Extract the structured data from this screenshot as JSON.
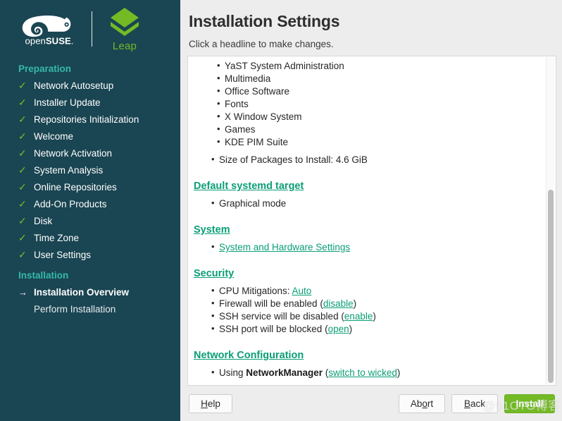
{
  "sidebar": {
    "brand": {
      "suse_logo": "opensuse-chameleon-logo",
      "product_name": "Leap"
    },
    "groups": [
      {
        "title": "Preparation",
        "items": [
          {
            "label": "Network Autosetup",
            "mark": "check"
          },
          {
            "label": "Installer Update",
            "mark": "check"
          },
          {
            "label": "Repositories Initialization",
            "mark": "check"
          },
          {
            "label": "Welcome",
            "mark": "check"
          },
          {
            "label": "Network Activation",
            "mark": "check"
          },
          {
            "label": "System Analysis",
            "mark": "check"
          },
          {
            "label": "Online Repositories",
            "mark": "check"
          },
          {
            "label": "Add-On Products",
            "mark": "check"
          },
          {
            "label": "Disk",
            "mark": "check"
          },
          {
            "label": "Time Zone",
            "mark": "check"
          },
          {
            "label": "User Settings",
            "mark": "check"
          }
        ]
      },
      {
        "title": "Installation",
        "items": [
          {
            "label": "Installation Overview",
            "mark": "arrow",
            "current": true
          },
          {
            "label": "Perform Installation",
            "mark": "none"
          }
        ]
      }
    ],
    "check_glyph": "✓",
    "arrow_glyph": "→"
  },
  "main": {
    "title": "Installation Settings",
    "subtitle": "Click a headline to make changes.",
    "software": {
      "nested_items": [
        "YaST System Administration",
        "Multimedia",
        "Office Software",
        "Fonts",
        "X Window System",
        "Games",
        "KDE PIM Suite"
      ],
      "size_line": "Size of Packages to Install: 4.6 GiB"
    },
    "sections": [
      {
        "heading": "Default systemd target",
        "items": [
          {
            "text": "Graphical mode"
          }
        ]
      },
      {
        "heading": "System",
        "items": [
          {
            "link": "System and Hardware Settings"
          }
        ]
      },
      {
        "heading": "Security",
        "items": [
          {
            "prefix": "CPU Mitigations: ",
            "link": "Auto",
            "suffix": ""
          },
          {
            "prefix": "Firewall will be enabled (",
            "link": "disable",
            "suffix": ")"
          },
          {
            "prefix": "SSH service will be disabled (",
            "link": "enable",
            "suffix": ")"
          },
          {
            "prefix": "SSH port will be blocked (",
            "link": "open",
            "suffix": ")"
          }
        ]
      },
      {
        "heading": "Network Configuration",
        "items": [
          {
            "prefix": "Using ",
            "bold": "NetworkManager",
            "mid": " (",
            "link": "switch to wicked",
            "suffix": ")"
          }
        ]
      }
    ]
  },
  "buttons": {
    "help": {
      "pre": "",
      "key": "H",
      "post": "elp"
    },
    "abort": {
      "pre": "Ab",
      "key": "o",
      "post": "rt"
    },
    "back": {
      "pre": "",
      "key": "B",
      "post": "ack"
    },
    "install": {
      "pre": "",
      "key": "I",
      "post": "nstall"
    }
  },
  "watermark": "@51CTO博客",
  "colors": {
    "sidebar_bg": "#1a4552",
    "group_title": "#35b9ab",
    "check_green": "#6fc02a",
    "leap_green": "#73ba25",
    "link_teal": "#0a9e76",
    "install_button": "#73ba25",
    "page_bg": "#ededed"
  }
}
